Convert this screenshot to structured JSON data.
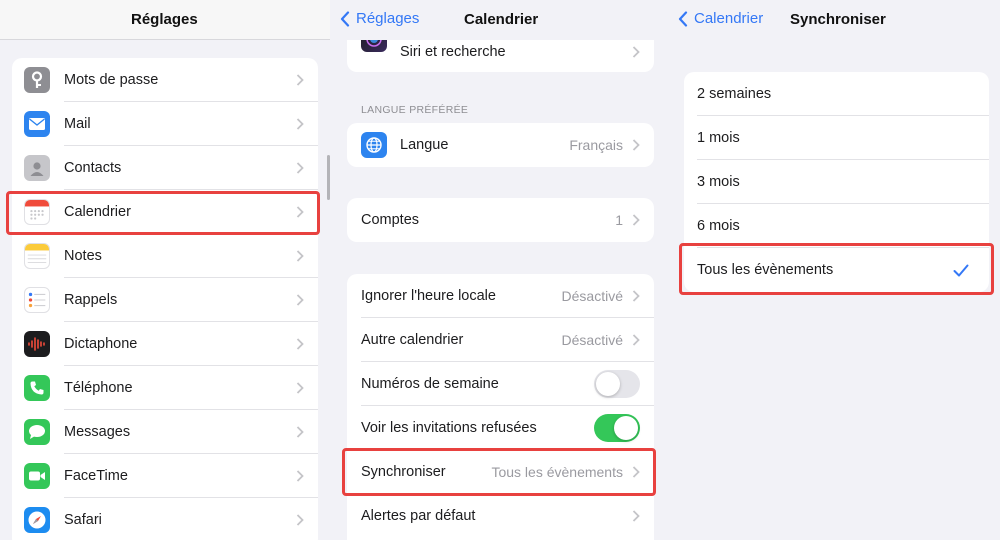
{
  "left_panel": {
    "title": "Réglages",
    "items": [
      {
        "label": "Mots de passe",
        "icon": "key-icon",
        "color": "#8e8e93"
      },
      {
        "label": "Mail",
        "icon": "mail-icon",
        "color": "#2d84ef"
      },
      {
        "label": "Contacts",
        "icon": "contacts-icon",
        "color": "#b9b9bd"
      },
      {
        "label": "Calendrier",
        "icon": "calendar-icon",
        "color": "#ffffff"
      },
      {
        "label": "Notes",
        "icon": "notes-icon",
        "color": "#ffffff"
      },
      {
        "label": "Rappels",
        "icon": "reminders-icon",
        "color": "#ffffff"
      },
      {
        "label": "Dictaphone",
        "icon": "dictaphone-icon",
        "color": "#1c1c1e"
      },
      {
        "label": "Téléphone",
        "icon": "phone-icon",
        "color": "#34c759"
      },
      {
        "label": "Messages",
        "icon": "messages-icon",
        "color": "#34c759"
      },
      {
        "label": "FaceTime",
        "icon": "facetime-icon",
        "color": "#34c759"
      },
      {
        "label": "Safari",
        "icon": "safari-icon",
        "color": "#1d8cf0"
      }
    ]
  },
  "middle_panel": {
    "back_label": "Réglages",
    "title": "Calendrier",
    "siri_label": "Siri et recherche",
    "language_section_header": "LANGUE PRÉFÉRÉE",
    "language_label": "Langue",
    "language_value": "Français",
    "accounts_label": "Comptes",
    "accounts_value": "1",
    "settings": [
      {
        "label": "Ignorer l'heure locale",
        "value": "Désactivé"
      },
      {
        "label": "Autre calendrier",
        "value": "Désactivé"
      },
      {
        "label": "Numéros de semaine",
        "toggle": false
      },
      {
        "label": "Voir les invitations refusées",
        "toggle": true
      },
      {
        "label": "Synchroniser",
        "value": "Tous les évènements"
      },
      {
        "label": "Alertes par défaut",
        "value": ""
      }
    ]
  },
  "right_panel": {
    "back_label": "Calendrier",
    "title": "Synchroniser",
    "options": [
      {
        "label": "2 semaines",
        "selected": false
      },
      {
        "label": "1 mois",
        "selected": false
      },
      {
        "label": "3 mois",
        "selected": false
      },
      {
        "label": "6 mois",
        "selected": false
      },
      {
        "label": "Tous les évènements",
        "selected": true
      }
    ]
  },
  "colors": {
    "accent": "#3478f6",
    "highlight": "#e8413f",
    "toggle_on": "#34c759",
    "toggle_off": "#e5e5ea"
  }
}
